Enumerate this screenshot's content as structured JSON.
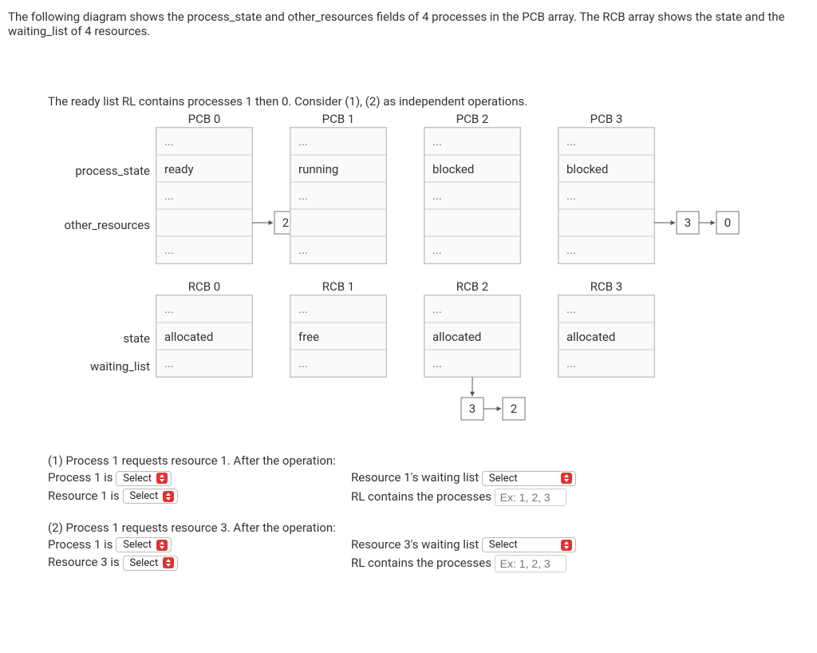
{
  "intro": "The following diagram shows the process_state and other_resources fields of 4 processes in the PCB array. The RCB array shows the state and the waiting_list of 4 resources.",
  "subintro": "The ready list RL contains processes 1 then 0. Consider (1), (2) as independent operations.",
  "pcb": {
    "headers": [
      "PCB 0",
      "PCB 1",
      "PCB 2",
      "PCB 3"
    ],
    "row_labels": {
      "process_state": "process_state",
      "other_resources": "other_resources"
    },
    "rows": {
      "process_state": [
        "ready",
        "running",
        "blocked",
        "blocked"
      ],
      "other_resources_links": {
        "0": [
          "2"
        ],
        "3": [
          "3",
          "0"
        ]
      }
    }
  },
  "rcb": {
    "headers": [
      "RCB 0",
      "RCB 1",
      "RCB 2",
      "RCB 3"
    ],
    "row_labels": {
      "state": "state",
      "waiting_list": "waiting_list"
    },
    "rows": {
      "state": [
        "allocated",
        "free",
        "allocated",
        "allocated"
      ],
      "waiting_list_chain": {
        "2": [
          "3",
          "2"
        ]
      }
    }
  },
  "dots": "...",
  "q1": {
    "heading": "(1) Process 1 requests resource 1. After the operation:",
    "l1": "Process 1 is",
    "l2": "Resource 1 is",
    "r1": "Resource 1's waiting list",
    "r2": "RL contains the processes"
  },
  "q2": {
    "heading": "(2) Process 1 requests resource 3. After the operation:",
    "l1": "Process 1 is",
    "l2": "Resource 3 is",
    "r1": "Resource 3's waiting list",
    "r2": "RL contains the processes"
  },
  "select_label": "Select",
  "placeholder": "Ex: 1, 2, 3"
}
